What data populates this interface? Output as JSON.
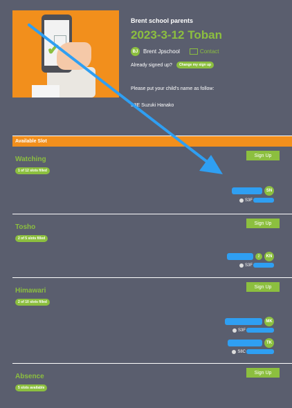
{
  "header": {
    "org": "Brent school parents",
    "title": "2023-3-12 Toban",
    "author_initials": "BJ",
    "author_name": "Brent Jpschool",
    "contact_label": "Contact",
    "signed_question": "Already signed up?",
    "change_label": "Change my sign up",
    "instruction": "Please put your child's name as follow:",
    "example": "S3E Suzuki Hanako"
  },
  "section": {
    "label": "Available Slot"
  },
  "slots": [
    {
      "name": "Watching",
      "status": "1 of 12 slots filled",
      "signup": "Sign Up",
      "entries": [
        {
          "initials": "SN",
          "tag": "S3F"
        }
      ]
    },
    {
      "name": "Tosho",
      "status": "2 of 5 slots filled",
      "signup": "Sign Up",
      "entries": [
        {
          "initials": "KN",
          "count": "2",
          "tag": "S3F"
        }
      ]
    },
    {
      "name": "Himawari",
      "status": "2 of 10 slots filled",
      "signup": "Sign Up",
      "entries": [
        {
          "initials": "MK",
          "tag": "S3F"
        },
        {
          "initials": "TK",
          "tag": "S8C"
        }
      ]
    },
    {
      "name": "Absence",
      "status": "5 slots available",
      "signup": "Sign Up",
      "entries": []
    }
  ],
  "colors": {
    "background": "#5a5e6e",
    "accent": "#8cbf3f",
    "orange": "#f28f1c",
    "redaction": "#2f9ff2"
  }
}
